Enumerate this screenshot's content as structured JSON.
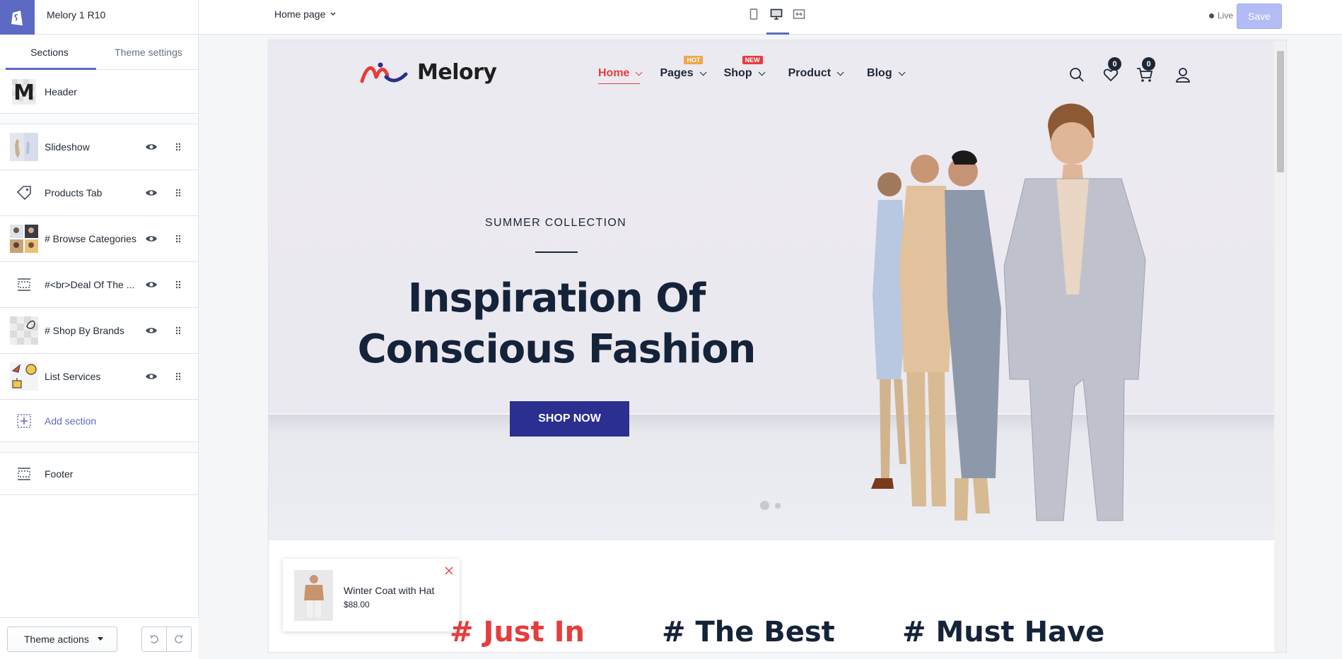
{
  "topbar": {
    "shop_name": "Melory 1 R10",
    "page_selector": "Home page",
    "status": "Live",
    "save_label": "Save"
  },
  "sidebar": {
    "tabs": [
      {
        "label": "Sections",
        "active": true
      },
      {
        "label": "Theme settings",
        "active": false
      }
    ],
    "header_section": "Header",
    "sections": [
      {
        "label": "Slideshow",
        "icon": "slideshow-thumb"
      },
      {
        "label": "Products Tab",
        "icon": "tag-icon"
      },
      {
        "label": "# Browse Categories",
        "icon": "categories-thumb"
      },
      {
        "label": "#<br>Deal Of The ...",
        "icon": "layout-icon"
      },
      {
        "label": "# Shop By Brands",
        "icon": "brands-thumb"
      },
      {
        "label": "List Services",
        "icon": "services-thumb"
      }
    ],
    "add_section": "Add section",
    "footer_section": "Footer",
    "theme_actions": "Theme actions"
  },
  "store": {
    "brand": "Melory",
    "nav": [
      {
        "label": "Home",
        "active": true,
        "badge": ""
      },
      {
        "label": "Pages",
        "active": false,
        "badge": "HOT"
      },
      {
        "label": "Shop",
        "active": false,
        "badge": "NEW"
      },
      {
        "label": "Product",
        "active": false,
        "badge": ""
      },
      {
        "label": "Blog",
        "active": false,
        "badge": ""
      }
    ],
    "wishlist_count": "0",
    "cart_count": "0",
    "hero": {
      "subtitle": "SUMMER COLLECTION",
      "title_line1": "Inspiration Of",
      "title_line2": "Conscious Fashion",
      "button": "SHOP NOW"
    },
    "popup": {
      "product_name": "Winter Coat with Hat",
      "price": "$88.00"
    },
    "product_tabs": [
      "# Just In",
      "# The Best",
      "# Must Have"
    ]
  },
  "colors": {
    "accent": "#5c6ac4",
    "brand_red": "#e53d3d",
    "cta": "#2b2f8f",
    "dark": "#15233a"
  }
}
